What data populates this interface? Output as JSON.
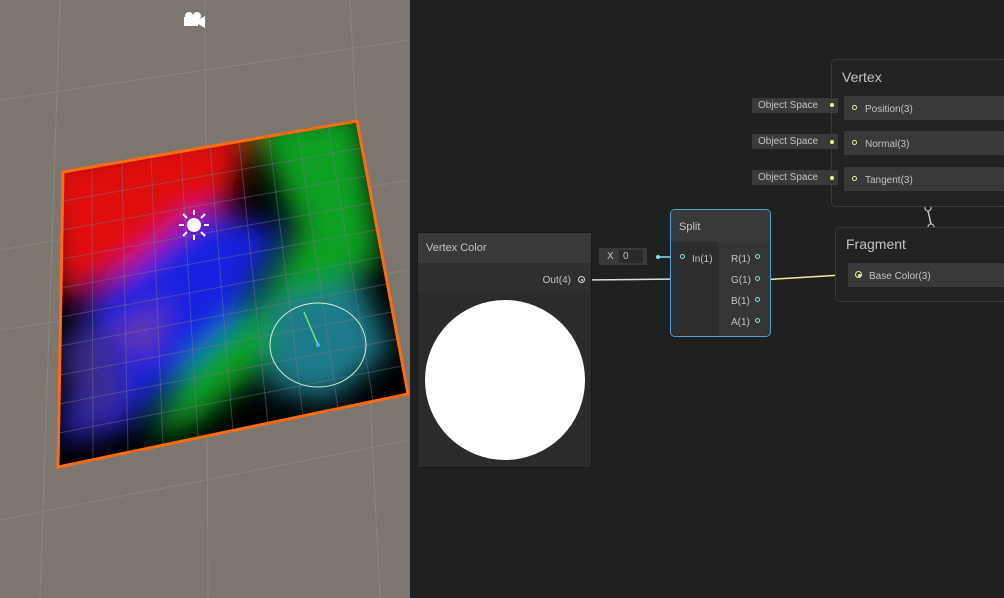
{
  "colors": {
    "scene_bg": "#7d766e",
    "graph_bg": "#202020",
    "selection_outline": "#ff6a13",
    "node_bg": "#2d2d2d",
    "selected_node_border": "#4fa3d6",
    "port_cyan": "#84e4e7",
    "port_yellow": "#f0f0a0"
  },
  "scene": {
    "camera_icon": "camera-gizmo-icon",
    "light_icon": "sun-light-gizmo-icon"
  },
  "graph": {
    "vertex_context": {
      "title": "Vertex",
      "blocks": [
        {
          "label": "Position(3)",
          "space": "Object Space"
        },
        {
          "label": "Normal(3)",
          "space": "Object Space"
        },
        {
          "label": "Tangent(3)",
          "space": "Object Space"
        }
      ]
    },
    "fragment_context": {
      "title": "Fragment",
      "blocks": [
        {
          "label": "Base Color(3)"
        }
      ]
    },
    "vertex_color_node": {
      "title": "Vertex Color",
      "output": "Out(4)"
    },
    "split_node": {
      "title": "Split",
      "input": "In(1)",
      "input_default_axis": "X",
      "input_default_value": "0",
      "outputs": [
        "R(1)",
        "G(1)",
        "B(1)",
        "A(1)"
      ]
    }
  }
}
